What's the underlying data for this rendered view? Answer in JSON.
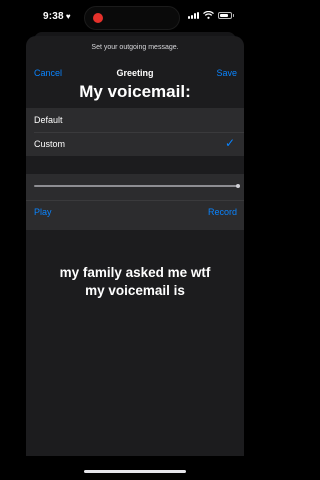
{
  "status_bar": {
    "time": "9:38",
    "heart": "♥",
    "recording_indicator_color": "#e5312b",
    "battery_level": 0.8
  },
  "sheet": {
    "prompt": "Set your outgoing message.",
    "nav": {
      "left_label": "Cancel",
      "title": "Greeting",
      "right_label": "Save"
    },
    "overlay_caption_top": "My voicemail:",
    "options": [
      {
        "label": "Default",
        "selected": false
      },
      {
        "label": "Custom",
        "selected": true,
        "check": "✓"
      }
    ],
    "audio": {
      "progress": 1.0,
      "play_label": "Play",
      "record_label": "Record"
    },
    "overlay_caption_bottom_line1": "my family asked me wtf",
    "overlay_caption_bottom_line2": "my voicemail is"
  },
  "colors": {
    "accent": "#0a84ff",
    "sheet_background": "#1c1c1e",
    "group_background": "#2c2c2e"
  },
  "icons": {
    "signal": "cellular-signal-icon",
    "wifi": "wifi-icon",
    "battery": "battery-icon",
    "checkmark": "checkmark-icon",
    "recording": "recording-indicator-icon"
  }
}
